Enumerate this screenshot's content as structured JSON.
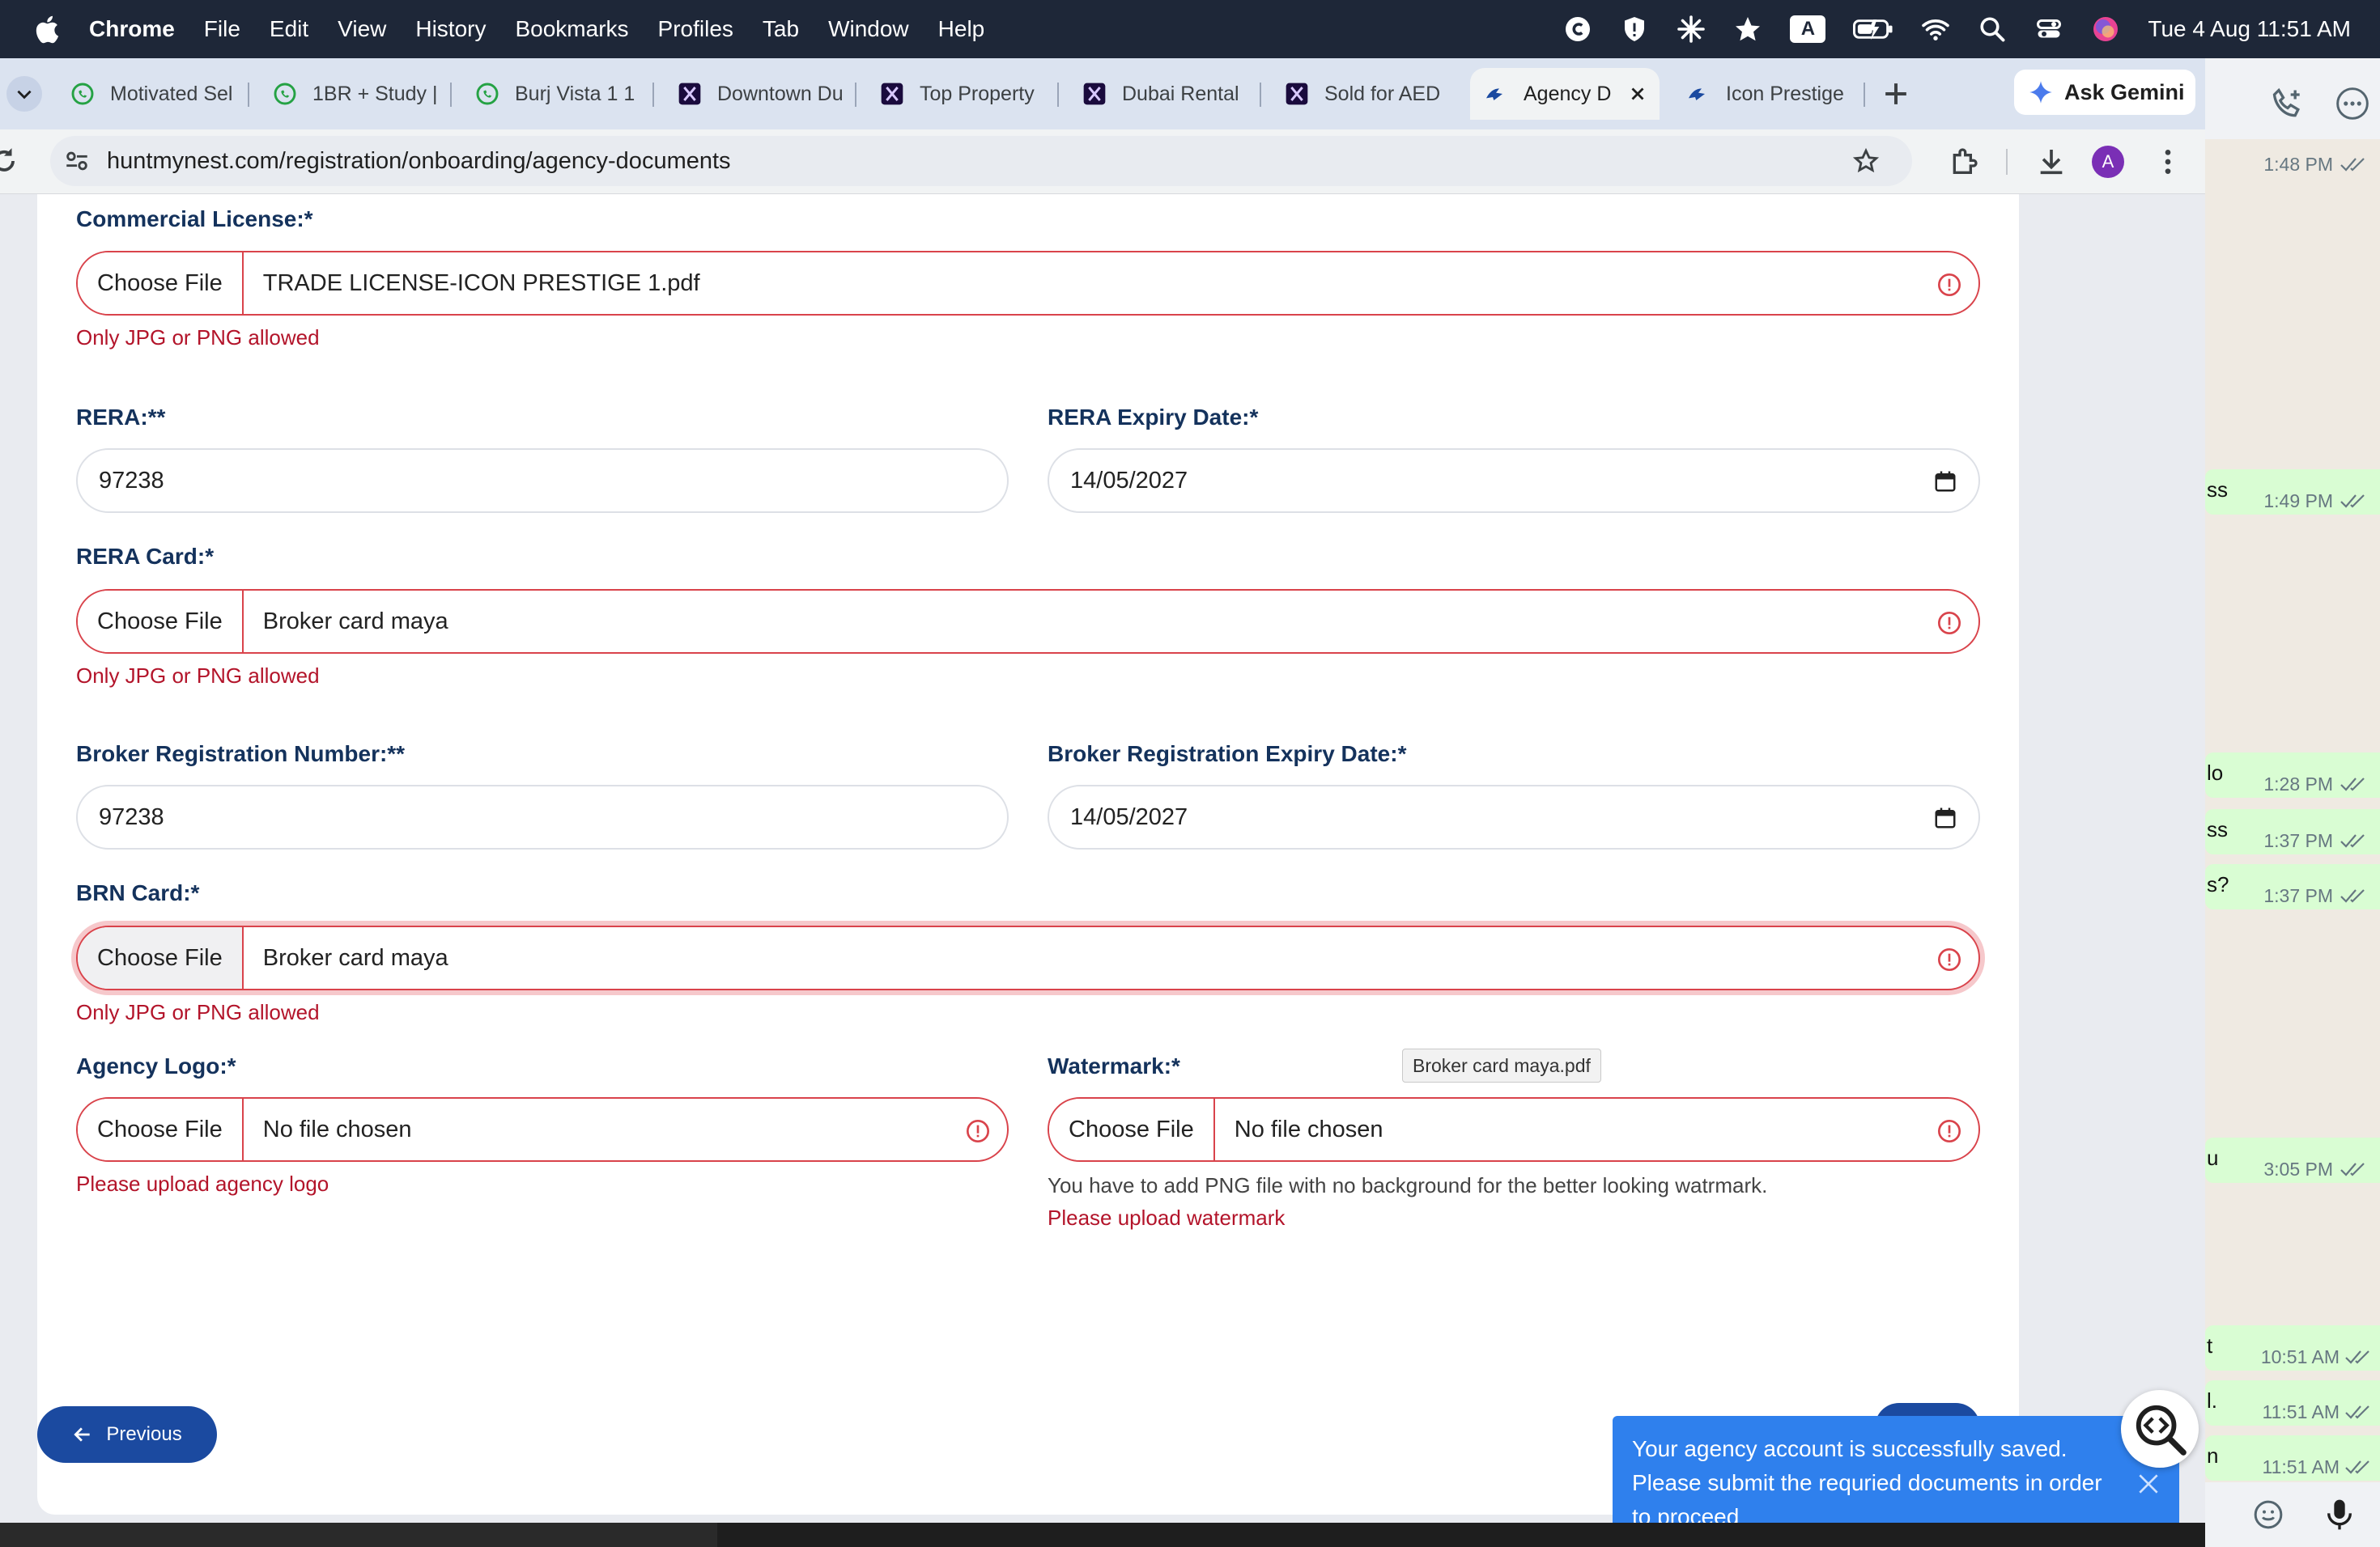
{
  "menubar": {
    "app": "Chrome",
    "items": [
      "File",
      "Edit",
      "View",
      "History",
      "Bookmarks",
      "Profiles",
      "Tab",
      "Window",
      "Help"
    ],
    "datetime": "Tue 4 Aug  11:51 AM",
    "input_source": "A"
  },
  "tabs": [
    {
      "title": "Motivated Sel",
      "icon": "whatsapp-icon"
    },
    {
      "title": "1BR + Study |",
      "icon": "whatsapp-icon"
    },
    {
      "title": "Burj Vista 1 1",
      "icon": "whatsapp-icon"
    },
    {
      "title": "Downtown Du",
      "icon": "x-icon"
    },
    {
      "title": "Top Property",
      "icon": "x-icon"
    },
    {
      "title": "Dubai Rental",
      "icon": "x-icon"
    },
    {
      "title": "Sold for AED",
      "icon": "x-icon"
    },
    {
      "title": "Agency D",
      "icon": "huntmynest-icon",
      "active": true
    },
    {
      "title": "Icon Prestige",
      "icon": "huntmynest-icon"
    }
  ],
  "gemini_label": "Ask Gemini",
  "profile_initial": "A",
  "url": "huntmynest.com/registration/onboarding/agency-documents",
  "form": {
    "choose_file_label": "Choose File",
    "commercial_license": {
      "label": "Commercial License:*",
      "file": "TRADE LICENSE-ICON PRESTIGE 1.pdf",
      "error": "Only JPG or PNG allowed"
    },
    "rera": {
      "label": "RERA:**",
      "value": "97238"
    },
    "rera_expiry": {
      "label": "RERA Expiry Date:*",
      "value": "14/05/2027"
    },
    "rera_card": {
      "label": "RERA Card:*",
      "file": "Broker card maya",
      "error": "Only JPG or PNG allowed"
    },
    "brn": {
      "label": "Broker Registration Number:**",
      "value": "97238"
    },
    "brn_expiry": {
      "label": "Broker Registration Expiry Date:*",
      "value": "14/05/2027"
    },
    "brn_card": {
      "label": "BRN Card:*",
      "file": "Broker card maya",
      "error": "Only JPG or PNG allowed",
      "tooltip": "Broker card maya.pdf"
    },
    "agency_logo": {
      "label": "Agency Logo:*",
      "file": "No file chosen",
      "error": "Please upload agency logo"
    },
    "watermark": {
      "label": "Watermark:*",
      "file": "No file chosen",
      "hint": "You have to add PNG file with no background for the better looking watrmark.",
      "error": "Please upload watermark"
    }
  },
  "previous_label": "Previous",
  "toast": "Your agency account is successfully saved. Please submit the requried documents in order to proceed",
  "whatsapp": [
    {
      "frag": "",
      "time": "1:48 PM"
    },
    {
      "frag": "ss",
      "time": "1:49 PM"
    },
    {
      "frag": "lo",
      "time": "1:28 PM"
    },
    {
      "frag": "ss",
      "time": "1:37 PM"
    },
    {
      "frag": "s?",
      "time": "1:37 PM"
    },
    {
      "frag": "u",
      "time": "3:05 PM"
    },
    {
      "frag": "t",
      "time": "10:51 AM"
    },
    {
      "frag": "l.",
      "time": "11:51 AM"
    },
    {
      "frag": "n",
      "time": "11:51 AM"
    }
  ],
  "colors": {
    "brand_blue": "#1b4aa0",
    "error_red": "#b3142a",
    "label_navy": "#14325c",
    "toast_blue": "#2f80ed"
  }
}
